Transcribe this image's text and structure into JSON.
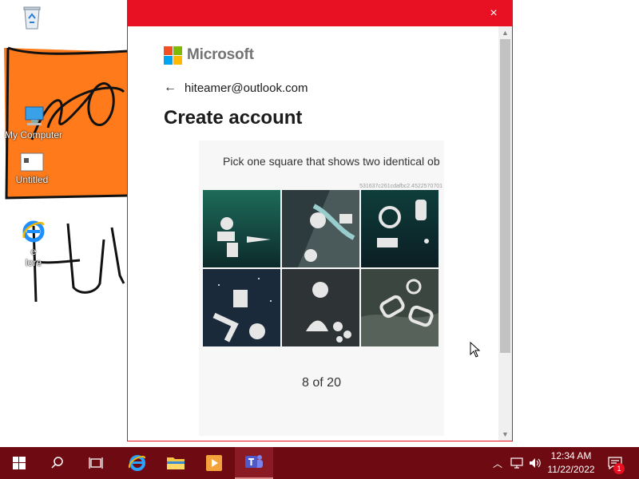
{
  "desktop": {
    "icons": [
      {
        "name": "recycle-bin",
        "label": ""
      },
      {
        "name": "my-computer",
        "label": "My Computer"
      },
      {
        "name": "untitled",
        "label": "Untitled"
      },
      {
        "name": "internet-explorer",
        "label": "e\nlore"
      }
    ]
  },
  "dialog": {
    "close_icon": "×",
    "brand": "Microsoft",
    "brand_colors": [
      "#f25022",
      "#7fba00",
      "#00a4ef",
      "#ffb900"
    ],
    "back_icon": "←",
    "identity": "hiteamer@outlook.com",
    "heading": "Create account",
    "accent_color": "#e81123"
  },
  "captcha": {
    "instruction": "Pick one square that shows two identical ob",
    "id": "531637c261cdafbc2.4522570701",
    "tiles": [
      {
        "label": "tile-1"
      },
      {
        "label": "tile-2"
      },
      {
        "label": "tile-3"
      },
      {
        "label": "tile-4"
      },
      {
        "label": "tile-5"
      },
      {
        "label": "tile-6"
      }
    ],
    "progress": "8 of 20"
  },
  "taskbar": {
    "color": "#6e0a12",
    "clock_time": "12:34 AM",
    "clock_date": "11/22/2022",
    "notifications": "1"
  }
}
